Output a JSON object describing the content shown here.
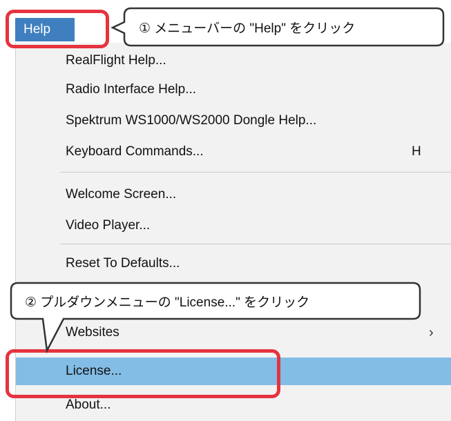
{
  "menubar": {
    "help_label": "Help"
  },
  "menu": {
    "items": [
      {
        "label": "RealFlight Help...",
        "shortcut": ""
      },
      {
        "label": "Radio Interface Help...",
        "shortcut": ""
      },
      {
        "label": "Spektrum WS1000/WS2000 Dongle Help...",
        "shortcut": ""
      },
      {
        "label": "Keyboard Commands...",
        "shortcut": "H"
      },
      {
        "label": "Welcome Screen...",
        "shortcut": ""
      },
      {
        "label": "Video Player...",
        "shortcut": ""
      },
      {
        "label": "Reset To Defaults...",
        "shortcut": ""
      },
      {
        "label": "Websites",
        "shortcut": "",
        "submenu_arrow": "›"
      },
      {
        "label": "License...",
        "shortcut": "",
        "highlighted": true
      },
      {
        "label": "About...",
        "shortcut": ""
      }
    ]
  },
  "callouts": {
    "step1": "① メニューバーの \"Help\" をクリック",
    "step2": "② プルダウンメニューの \"License...\" をクリック"
  },
  "colors": {
    "menubar_selected": "#3f7fbf",
    "highlight": "#83bde6",
    "annotation_red": "#e5333f"
  }
}
